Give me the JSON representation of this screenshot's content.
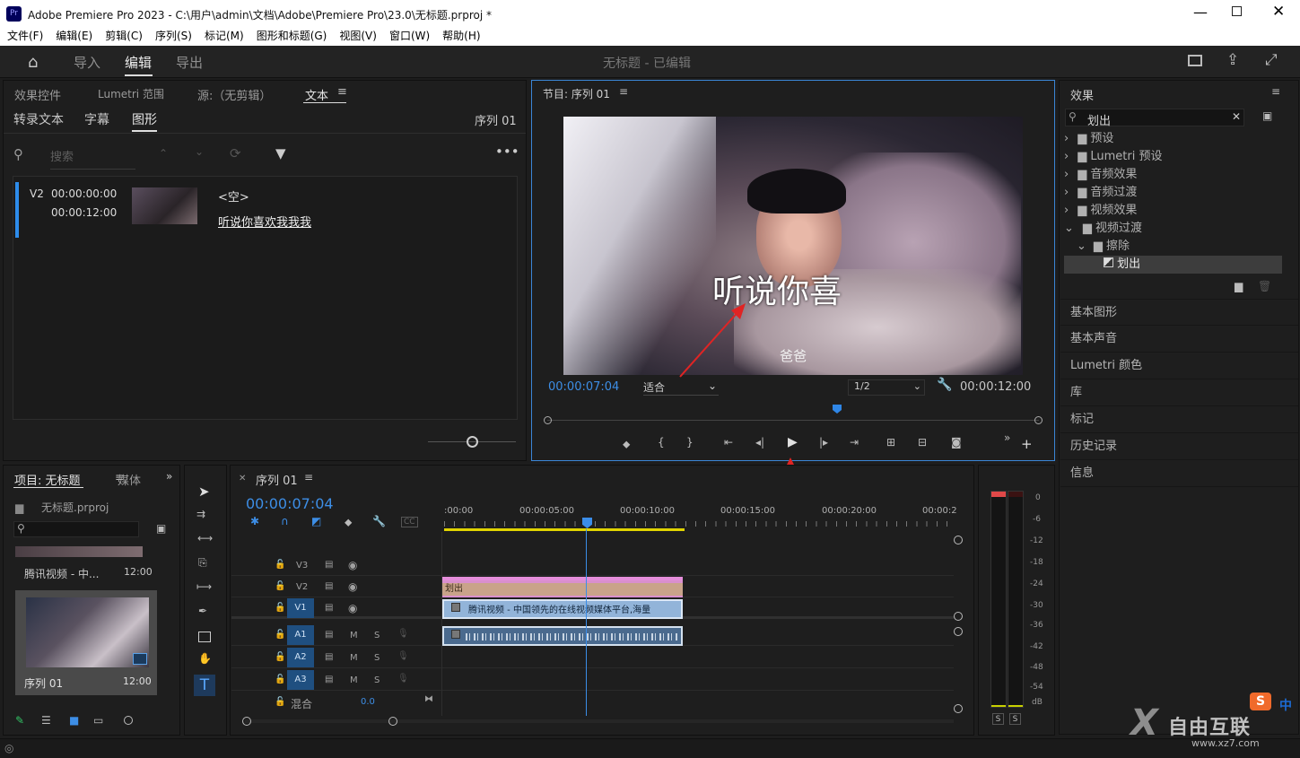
{
  "window": {
    "title": "Adobe Premiere Pro 2023 - C:\\用户\\admin\\文档\\Adobe\\Premiere Pro\\23.0\\无标题.prproj *",
    "app_icon": "Pr"
  },
  "menu": [
    "文件(F)",
    "编辑(E)",
    "剪辑(C)",
    "序列(S)",
    "标记(M)",
    "图形和标题(G)",
    "视图(V)",
    "窗口(W)",
    "帮助(H)"
  ],
  "appbar": {
    "import": "导入",
    "edit": "编辑",
    "export": "导出",
    "project_status": "无标题 - 已编辑"
  },
  "left_top": {
    "tabs": [
      "效果控件",
      "Lumetri 范围",
      "源:（无剪辑）",
      "文本"
    ],
    "subtabs": [
      "转录文本",
      "字幕",
      "图形"
    ],
    "sequence_label": "序列 01",
    "search_placeholder": "搜索",
    "entry": {
      "track": "V2",
      "start": "00:00:00:00",
      "end": "00:00:12:00",
      "empty": "<空>",
      "text": "听说你喜欢我我我"
    }
  },
  "program": {
    "title": "节目: 序列 01",
    "overlay_text": "听说你喜",
    "subtitle": "爸爸",
    "timecode": "00:00:07:04",
    "fit": "适合",
    "resolution": "1/2",
    "duration": "00:00:12:00",
    "playhead_fraction": 0.59
  },
  "effects": {
    "title": "效果",
    "search_value": "划出",
    "tree": [
      "预设",
      "Lumetri 预设",
      "音频效果",
      "音频过渡",
      "视频效果",
      "视频过渡",
      "擦除",
      "划出"
    ],
    "panels": [
      "基本图形",
      "基本声音",
      "Lumetri 颜色",
      "库",
      "标记",
      "历史记录",
      "信息"
    ]
  },
  "project": {
    "tabs": [
      "项目: 无标题",
      "媒体"
    ],
    "file": "无标题.prproj",
    "items": [
      {
        "name": "腾讯视频 - 中...",
        "duration": "12:00"
      },
      {
        "name": "序列 01",
        "duration": "12:00"
      }
    ]
  },
  "timeline": {
    "title": "序列 01",
    "timecode": "00:00:07:04",
    "ruler": [
      ":00:00",
      "00:00:05:00",
      "00:00:10:00",
      "00:00:15:00",
      "00:00:20:00",
      "00:00:2"
    ],
    "tracks": {
      "v3": "V3",
      "v2": "V2",
      "v1": "V1",
      "a1": "A1",
      "a2": "A2",
      "a3": "A3",
      "mix": "混合",
      "mix_value": "0.0"
    },
    "m": "M",
    "s": "S",
    "clips": {
      "transition": "划出",
      "video": "腾讯视频 - 中国领先的在线视频媒体平台,海量"
    }
  },
  "meter": {
    "scale": [
      "0",
      "-6",
      "-12",
      "-18",
      "-24",
      "-30",
      "-36",
      "-42",
      "-48",
      "-54",
      "dB"
    ],
    "solo": "S"
  },
  "watermark": {
    "text": "自由互联",
    "url": "www.xz7.com",
    "ime": "中"
  }
}
